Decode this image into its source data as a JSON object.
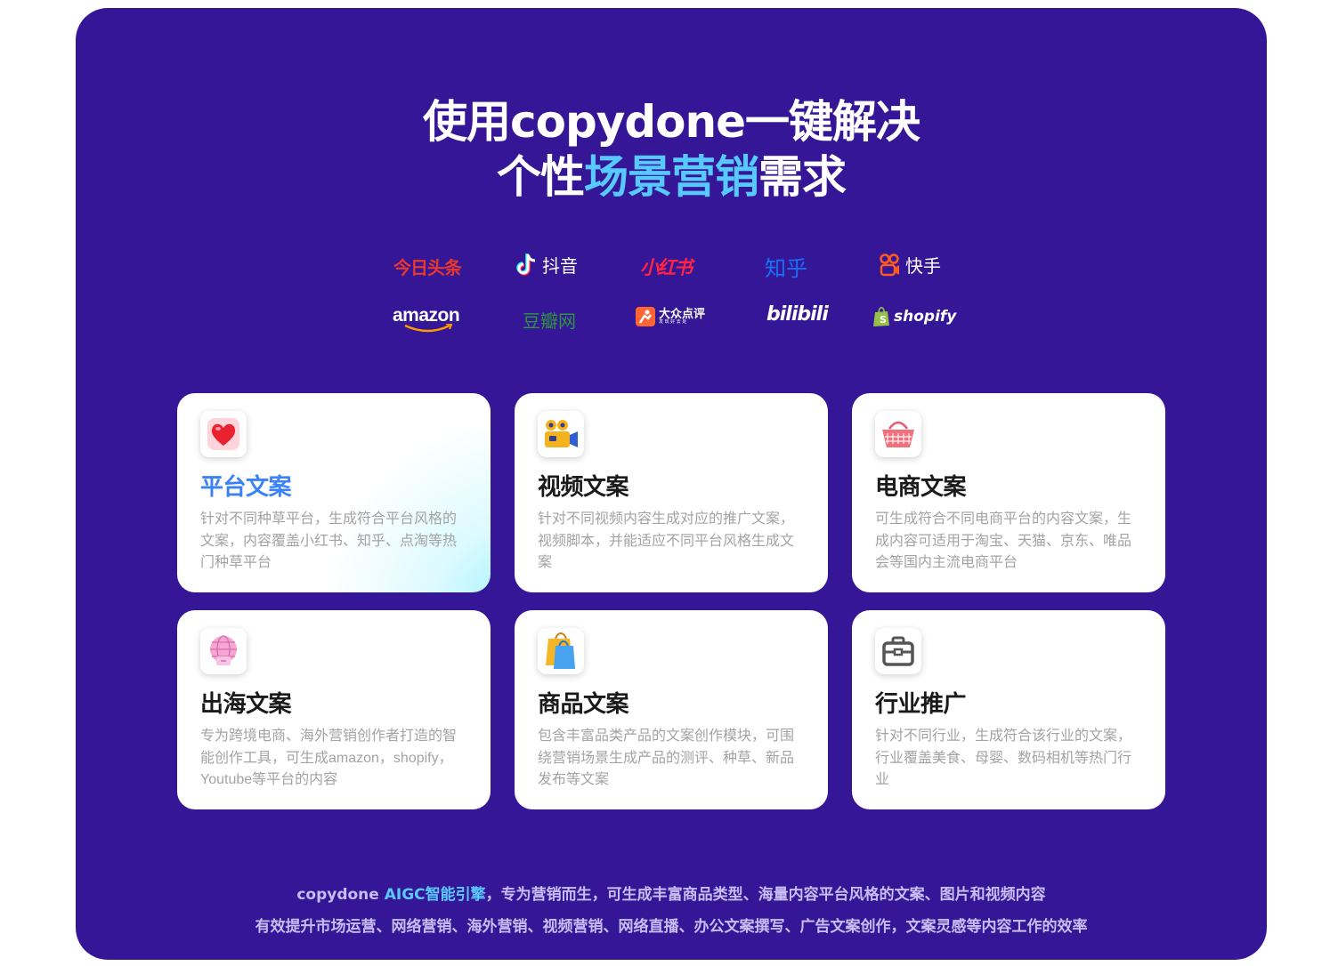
{
  "headline": {
    "line1": "使用copydone一键解决",
    "line2_pre": "个性",
    "line2_highlight": "场景营销",
    "line2_post": "需求"
  },
  "platforms": [
    {
      "name": "今日头条",
      "color": "#e8372c",
      "icon": "toutiao-logo"
    },
    {
      "name": "抖音",
      "color": "#ffffff",
      "icon": "douyin-icon"
    },
    {
      "name": "小红书",
      "color": "#ff2442",
      "icon": "xiaohongshu-logo"
    },
    {
      "name": "知乎",
      "color": "#1772f6",
      "icon": "zhihu-logo"
    },
    {
      "name": "快手",
      "color": "#ffffff",
      "icon": "kuaishou-icon"
    },
    {
      "name": "amazon",
      "color": "#ffffff",
      "icon": "amazon-logo"
    },
    {
      "name": "豆瓣网",
      "color": "#2e963d",
      "icon": "douban-logo"
    },
    {
      "name": "大众点评",
      "sub": "发 现 好 去 处",
      "color": "#ffffff",
      "icon": "dianping-icon"
    },
    {
      "name": "bilibili",
      "color": "#ffffff",
      "icon": "bilibili-logo"
    },
    {
      "name": "shopify",
      "color": "#ffffff",
      "icon": "shopify-bag-icon"
    }
  ],
  "cards": [
    {
      "title": "平台文案",
      "desc": "针对不同种草平台，生成符合平台风格的文案，内容覆盖小红书、知乎、点淘等热门种草平台",
      "icon": "heart-icon",
      "active": true
    },
    {
      "title": "视频文案",
      "desc": "针对不同视频内容生成对应的推广文案，视频脚本，并能适应不同平台风格生成文案",
      "icon": "video-camera-icon"
    },
    {
      "title": "电商文案",
      "desc": "可生成符合不同电商平台的内容文案，生成内容可适用于淘宝、天猫、京东、唯品会等国内主流电商平台",
      "icon": "shopping-basket-icon"
    },
    {
      "title": "出海文案",
      "desc": "专为跨境电商、海外营销创作者打造的智能创作工具，可生成amazon，shopify，Youtube等平台的内容",
      "icon": "globe-icon"
    },
    {
      "title": "商品文案",
      "desc": "包含丰富品类产品的文案创作模块，可围绕营销场景生成产品的测评、种草、新品发布等文案",
      "icon": "shopping-bag-icon"
    },
    {
      "title": "行业推广",
      "desc": "针对不同行业，生成符合该行业的文案，行业覆盖美食、母婴、数码相机等热门行业",
      "icon": "briefcase-icon"
    }
  ],
  "footer": {
    "line1_pre": "copydone ",
    "line1_brand": "AIGC智能引擎",
    "line1_post": "，专为营销而生，可生成丰富商品类型、海量内容平台风格的文案、图片和视频内容",
    "line2": "有效提升市场运营、网络营销、海外营销、视频营销、网络直播、办公文案撰写、广告文案创作，文案灵感等内容工作的效率"
  },
  "colors": {
    "panel_bg": "#341697",
    "highlight": "#58c9ff",
    "active_title": "#3b82f6"
  }
}
